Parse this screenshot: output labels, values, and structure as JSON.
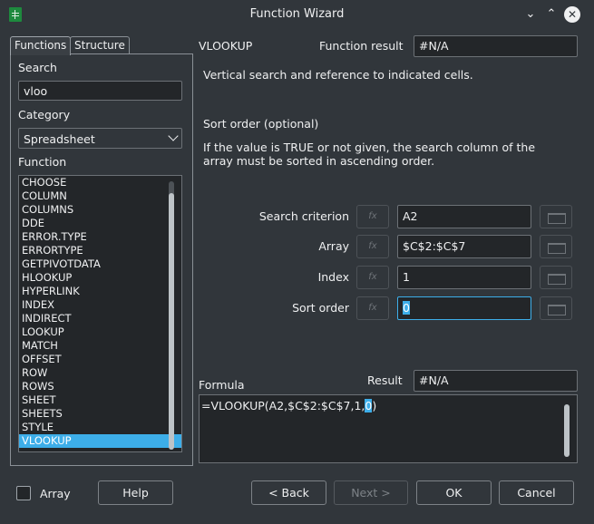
{
  "window": {
    "title": "Function Wizard"
  },
  "tabs": [
    {
      "label": "Functions"
    },
    {
      "label": "Structure"
    }
  ],
  "search": {
    "label": "Search",
    "value": "vloo"
  },
  "category": {
    "label": "Category",
    "selected": "Spreadsheet"
  },
  "function_list": {
    "label": "Function",
    "items": [
      "CHOOSE",
      "COLUMN",
      "COLUMNS",
      "DDE",
      "ERROR.TYPE",
      "ERRORTYPE",
      "GETPIVOTDATA",
      "HLOOKUP",
      "HYPERLINK",
      "INDEX",
      "INDIRECT",
      "LOOKUP",
      "MATCH",
      "OFFSET",
      "ROW",
      "ROWS",
      "SHEET",
      "SHEETS",
      "STYLE",
      "VLOOKUP"
    ],
    "selected": "VLOOKUP"
  },
  "function": {
    "name": "VLOOKUP",
    "result_label": "Function result",
    "result_value": "#N/A",
    "description": "Vertical search and reference to indicated cells.",
    "arg_title": "Sort order (optional)",
    "arg_description": "If the value is TRUE or not given, the search column of the array must be sorted in ascending order."
  },
  "arguments": [
    {
      "label": "Search criterion",
      "value": "A2"
    },
    {
      "label": "Array",
      "value": "$C$2:$C$7"
    },
    {
      "label": "Index",
      "value": "1"
    },
    {
      "label": "Sort order",
      "value": "0"
    }
  ],
  "fx_symbol": "fx",
  "formula": {
    "label": "Formula",
    "prefix": "=VLOOKUP(A2,$C$2:$C$7,1,",
    "highlight": "0",
    "suffix": ")"
  },
  "result": {
    "label": "Result",
    "value": "#N/A"
  },
  "buttons": {
    "array": "Array",
    "help": "Help",
    "back": "< Back",
    "next": "Next >",
    "ok": "OK",
    "cancel": "Cancel"
  }
}
